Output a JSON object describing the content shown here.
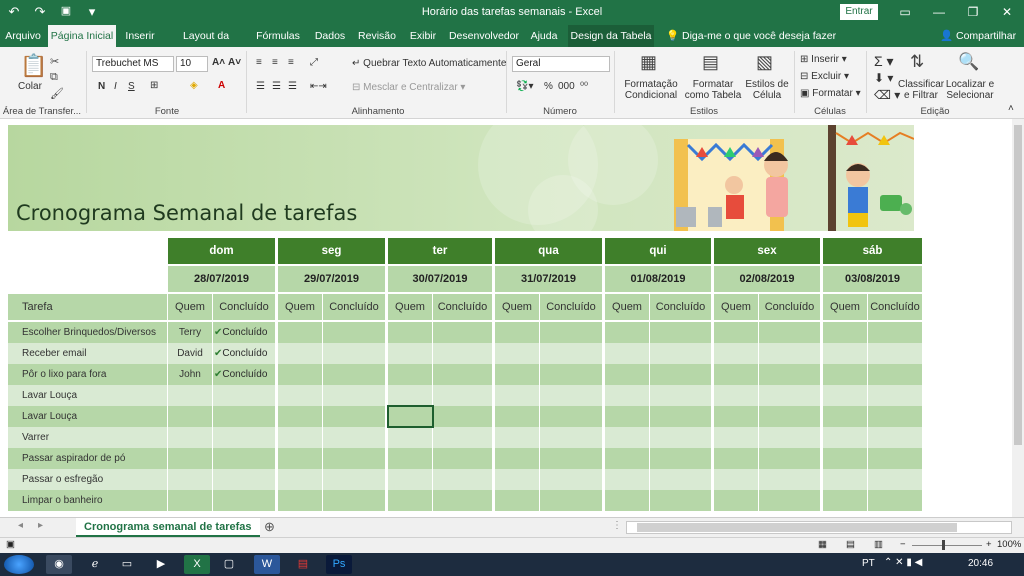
{
  "window": {
    "title": "Horário das tarefas semanais - Excel",
    "signin": "Entrar"
  },
  "qat": {
    "undo": "↶",
    "redo": "↷",
    "save": "💾",
    "more": "▾"
  },
  "tabs": [
    "Arquivo",
    "Página Inicial",
    "Inserir",
    "Layout da Página",
    "Fórmulas",
    "Dados",
    "Revisão",
    "Exibir",
    "Desenvolvedor",
    "Ajuda",
    "Design da Tabela"
  ],
  "tellme": "Diga-me o que você deseja fazer",
  "share": "Compartilhar",
  "ribbon": {
    "paste": "Colar",
    "clipboard_group": "Área de Transfer...",
    "font_name": "Trebuchet MS",
    "font_size": "10",
    "font_group": "Fonte",
    "wrap_text": "Quebrar Texto Automaticamente",
    "merge": "Mesclar e Centralizar",
    "align_group": "Alinhamento",
    "number_format": "Geral",
    "number_group": "Número",
    "cond_format": "Formatação Condicional",
    "format_table": "Formatar como Tabela",
    "cell_styles": "Estilos de Célula",
    "styles_group": "Estilos",
    "insert": "Inserir",
    "delete": "Excluir",
    "format": "Formatar",
    "cells_group": "Células",
    "sort": "Classificar e Filtrar",
    "find": "Localizar e Selecionar",
    "edit_group": "Edição"
  },
  "banner": {
    "title": "Cronograma Semanal de tarefas"
  },
  "days": [
    {
      "name": "dom",
      "date": "28/07/2019"
    },
    {
      "name": "seg",
      "date": "29/07/2019"
    },
    {
      "name": "ter",
      "date": "30/07/2019"
    },
    {
      "name": "qua",
      "date": "31/07/2019"
    },
    {
      "name": "qui",
      "date": "01/08/2019"
    },
    {
      "name": "sex",
      "date": "02/08/2019"
    },
    {
      "name": "sáb",
      "date": "03/08/2019"
    }
  ],
  "headers": {
    "task": "Tarefa",
    "who": "Quem",
    "done": "Concluído"
  },
  "tasks": [
    {
      "task": "Escolher Brinquedos/Diversos",
      "who": "Terry",
      "done": "✔Concluído"
    },
    {
      "task": "Receber email",
      "who": "David",
      "done": "✔Concluído"
    },
    {
      "task": "Pôr o lixo para fora",
      "who": "John",
      "done": "✔Concluído"
    },
    {
      "task": "Lavar Louça",
      "who": "",
      "done": ""
    },
    {
      "task": "Lavar Louça",
      "who": "",
      "done": ""
    },
    {
      "task": "Varrer",
      "who": "",
      "done": ""
    },
    {
      "task": "Passar aspirador de pó",
      "who": "",
      "done": ""
    },
    {
      "task": "Passar o esfregão",
      "who": "",
      "done": ""
    },
    {
      "task": "Limpar o banheiro",
      "who": "",
      "done": ""
    }
  ],
  "sheet_tab": "Cronograma semanal de tarefas",
  "zoom": "100%",
  "tray": {
    "lang": "PT",
    "time": "20:46"
  },
  "colors": {
    "excel_green": "#217346",
    "day_header": "#3f7f2a",
    "light": "#d9ead3",
    "mid": "#b6d7a8"
  }
}
